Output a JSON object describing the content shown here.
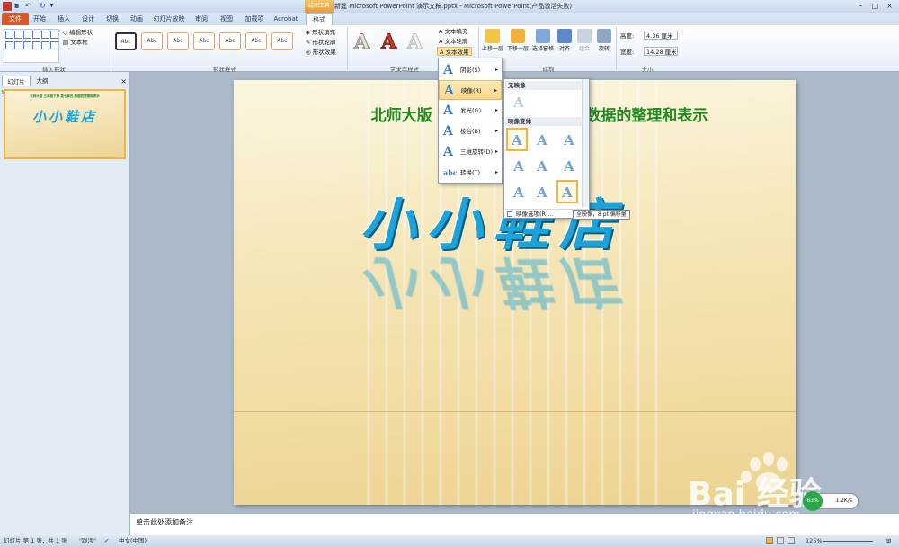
{
  "window": {
    "title": "新建 Microsoft PowerPoint 演示文稿.pptx - Microsoft PowerPoint(产品激活失败)",
    "context_tab_group": "绘图工具",
    "controls": [
      "–",
      "□",
      "×"
    ]
  },
  "tabs": [
    {
      "label": "文件"
    },
    {
      "label": "开始"
    },
    {
      "label": "插入"
    },
    {
      "label": "设计"
    },
    {
      "label": "切换"
    },
    {
      "label": "动画"
    },
    {
      "label": "幻灯片放映"
    },
    {
      "label": "审阅"
    },
    {
      "label": "视图"
    },
    {
      "label": "加载项"
    },
    {
      "label": "Acrobat"
    },
    {
      "label": "格式"
    }
  ],
  "ribbon": {
    "insert_shapes": {
      "label": "插入形状",
      "edit_shape": "编辑形状",
      "text_box": "文本框"
    },
    "shape_styles": {
      "label": "形状样式",
      "swatch_text": "Abc",
      "shape_fill": "形状填充",
      "shape_outline": "形状轮廓",
      "shape_effects": "形状效果"
    },
    "wordart_styles": {
      "label": "艺术字样式",
      "letter": "A",
      "text_fill": "文本填充",
      "text_outline": "文本轮廓",
      "text_effects": "文本效果"
    },
    "arrange": {
      "label": "排列",
      "bring_forward": "上移一层",
      "send_backward": "下移一层",
      "selection_pane": "选择窗格",
      "align": "对齐",
      "group": "组合",
      "rotate": "旋转"
    },
    "size": {
      "label": "大小",
      "height_label": "高度:",
      "height_value": "4.36 厘米",
      "width_label": "宽度:",
      "width_value": "14.28 厘米"
    }
  },
  "left_panel": {
    "tab_slides": "幻灯片",
    "tab_outline": "大纲",
    "close": "×",
    "slide_number": "1",
    "thumb_subtitle": "北师大版 三年级下册 第七单元 数据的整理和表示",
    "thumb_title": "小小鞋店"
  },
  "slide": {
    "subtitle": "北师大版 三年级下册 第七单元 数据的整理和表示",
    "title": "小小鞋店"
  },
  "effects_menu": {
    "items": [
      {
        "label": "阴影(S)",
        "icon": "A"
      },
      {
        "label": "映像(R)",
        "icon": "A"
      },
      {
        "label": "发光(G)",
        "icon": "A"
      },
      {
        "label": "棱台(B)",
        "icon": "A"
      },
      {
        "label": "三维旋转(D)",
        "icon": "A"
      },
      {
        "label": "转换(T)",
        "icon": "abc"
      }
    ],
    "arrow": "▸"
  },
  "reflection_submenu": {
    "no_reflection": "无映像",
    "variants": "映像变体",
    "options": "映像选项(R)...",
    "cell_letter": "A"
  },
  "tooltip": "全映像，8 pt 偏移量",
  "notes_placeholder": "单击此处添加备注",
  "statusbar": {
    "slide_info": "幻灯片 第 1 张，共 1 张",
    "theme": "\"跋涉\"",
    "language": "中文(中国)",
    "zoom": "125%"
  },
  "watermark": {
    "brand": "Bai 经验",
    "url": "jingyan.baidu.com"
  },
  "network_badge": {
    "percent": "63%",
    "speed": "1.2K/s"
  },
  "colors": {
    "accent_file_tab": "#d7582b",
    "title_green": "#1f8a1f",
    "wordart_blue": "#1ea3d8",
    "highlight": "#f2b343"
  }
}
